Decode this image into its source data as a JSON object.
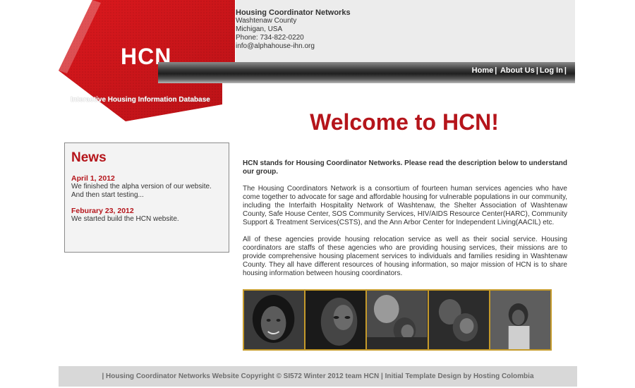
{
  "brand": {
    "logo_text": "HCN",
    "tagline": "Interactive Housing Information Database",
    "colors": {
      "accent_red": "#b5151b",
      "gold": "#c59a2a",
      "nav_dark": "#1f1f1f"
    }
  },
  "contact": {
    "org": "Housing Coordinator Networks",
    "line1": "Washtenaw County",
    "line2": "Michigan, USA",
    "phone": "Phone: 734-822-0220",
    "email": "info@alphahouse-ihn.org"
  },
  "nav": {
    "home": "Home",
    "about": "About Us",
    "login": "Log In",
    "sep": "|"
  },
  "news": {
    "title": "News",
    "items": [
      {
        "date": "April 1, 2012",
        "text": "We finished the alpha version of our website. And then start testing..."
      },
      {
        "date": "Feburary 23, 2012",
        "text": "We started build the HCN website."
      }
    ]
  },
  "main": {
    "welcome": "Welcome to HCN!",
    "lead": "HCN stands for Housing Coordinator Networks. Please read the description below to understand our group.",
    "para1": "The Housing Coordinators Network is a consortium of fourteen human services agencies who have come together to advocate for sage and affordable housing for vulnerable populations in our community, including the Interfaith Hospitality Network of Washtenaw, the Shelter Association of Washtenaw County, Safe House Center, SOS Community Services, HIV/AIDS Resource Center(HARC), Community Support & Treatment Services(CSTS), and the Ann Arbor Center for Independent Living(AACIL) etc.",
    "para2": "All of these agencies provide housing relocation service as well as their social service. Housing coordinators are staffs of these agencies who are providing housing services, their missions are to provide comprehensive housing placement services to individuals and families residing in Washtenaw County. They all have different resources of housing information, so major mission of HCN is to share housing information between housing coordinators."
  },
  "footer": {
    "text": "| Housing Coordinator Networks Website Copyright © SI572 Winter 2012 team HCN | Initial Template Design by Hosting Colombia"
  }
}
